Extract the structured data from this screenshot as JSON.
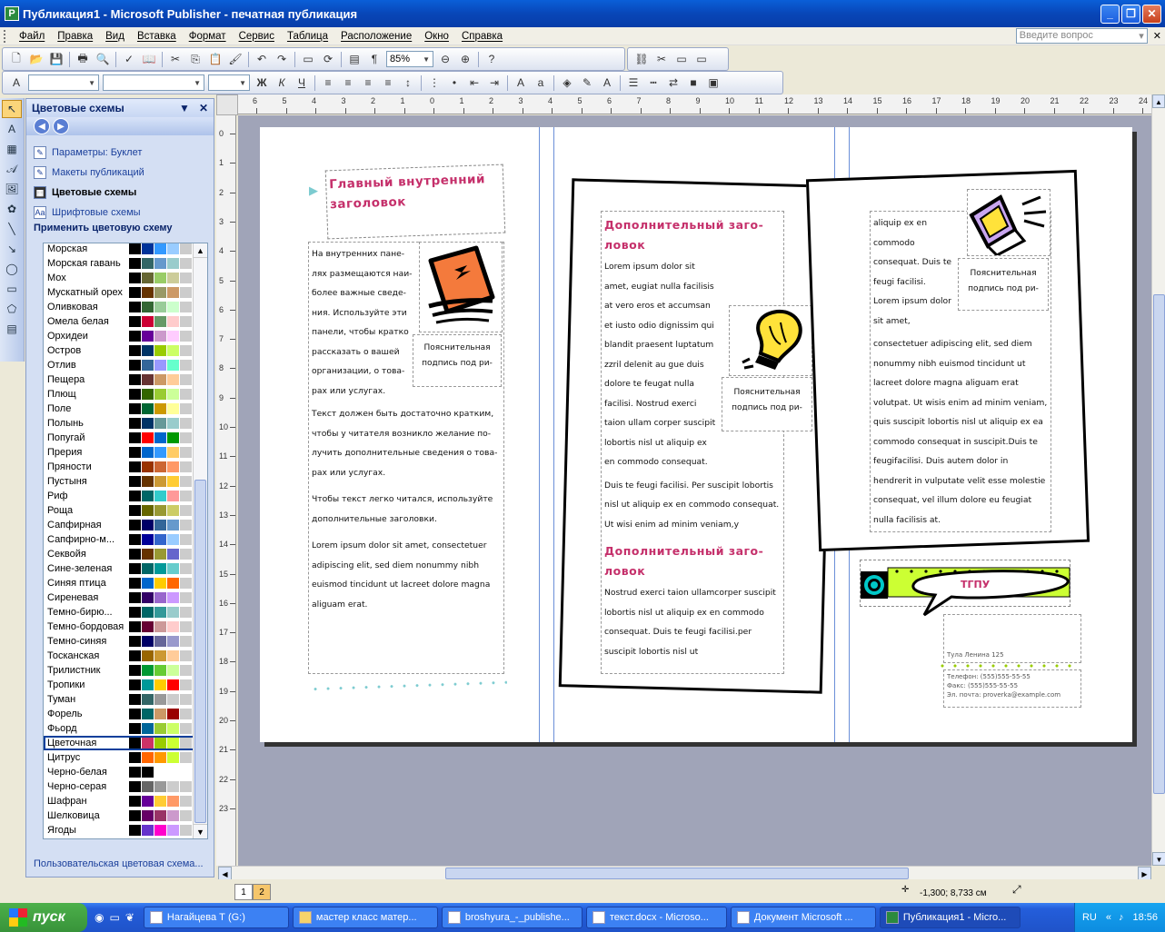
{
  "window": {
    "title": "Публикация1 - Microsoft Publisher - печатная публикация"
  },
  "menu": {
    "items": [
      "Файл",
      "Правка",
      "Вид",
      "Вставка",
      "Формат",
      "Сервис",
      "Таблица",
      "Расположение",
      "Окно",
      "Справка"
    ],
    "ask_placeholder": "Введите вопрос"
  },
  "toolbar": {
    "zoom": "85%"
  },
  "taskpane": {
    "title": "Цветовые схемы",
    "links": [
      {
        "label": "Параметры: Буклет",
        "icon": "options-icon"
      },
      {
        "label": "Макеты публикаций",
        "icon": "layouts-icon"
      },
      {
        "label": "Цветовые схемы",
        "icon": "color-schemes-icon"
      },
      {
        "label": "Шрифтовые схемы",
        "icon": "font-schemes-icon"
      }
    ],
    "apply_label": "Применить цветовую схему",
    "selected_scheme": "Цветочная",
    "custom_link": "Пользовательская цветовая схема...",
    "schemes": [
      {
        "name": "Морская",
        "colors": [
          "#000000",
          "#003399",
          "#3399ff",
          "#99ccff",
          "#cccccc"
        ]
      },
      {
        "name": "Морская гавань",
        "colors": [
          "#000000",
          "#336666",
          "#6699cc",
          "#99cccc",
          "#cccccc"
        ]
      },
      {
        "name": "Мох",
        "colors": [
          "#000000",
          "#666633",
          "#99cc66",
          "#cccc99",
          "#cccccc"
        ]
      },
      {
        "name": "Мускатный орех",
        "colors": [
          "#000000",
          "#663300",
          "#999966",
          "#cc9966",
          "#cccccc"
        ]
      },
      {
        "name": "Оливковая",
        "colors": [
          "#000000",
          "#336633",
          "#99cc99",
          "#ccffcc",
          "#cccccc"
        ]
      },
      {
        "name": "Омела белая",
        "colors": [
          "#000000",
          "#cc0033",
          "#669966",
          "#ffcccc",
          "#cccccc"
        ]
      },
      {
        "name": "Орхидеи",
        "colors": [
          "#000000",
          "#660099",
          "#cc99cc",
          "#ffccff",
          "#cccccc"
        ]
      },
      {
        "name": "Остров",
        "colors": [
          "#000000",
          "#003366",
          "#99cc00",
          "#ccff66",
          "#cccccc"
        ]
      },
      {
        "name": "Отлив",
        "colors": [
          "#000000",
          "#336699",
          "#9999ff",
          "#66ffcc",
          "#cccccc"
        ]
      },
      {
        "name": "Пещера",
        "colors": [
          "#000000",
          "#663333",
          "#cc9966",
          "#ffcc99",
          "#cccccc"
        ]
      },
      {
        "name": "Плющ",
        "colors": [
          "#000000",
          "#336600",
          "#99cc33",
          "#ccff99",
          "#cccccc"
        ]
      },
      {
        "name": "Поле",
        "colors": [
          "#000000",
          "#006633",
          "#cc9900",
          "#ffff99",
          "#cccccc"
        ]
      },
      {
        "name": "Полынь",
        "colors": [
          "#000000",
          "#003366",
          "#669999",
          "#99cccc",
          "#cccccc"
        ]
      },
      {
        "name": "Попугай",
        "colors": [
          "#000000",
          "#ff0000",
          "#0066cc",
          "#009900",
          "#cccccc"
        ]
      },
      {
        "name": "Прерия",
        "colors": [
          "#000000",
          "#0066cc",
          "#3399ff",
          "#ffcc66",
          "#cccccc"
        ]
      },
      {
        "name": "Пряности",
        "colors": [
          "#000000",
          "#993300",
          "#cc6633",
          "#ff9966",
          "#cccccc"
        ]
      },
      {
        "name": "Пустыня",
        "colors": [
          "#000000",
          "#663300",
          "#cc9933",
          "#ffcc33",
          "#cccccc"
        ]
      },
      {
        "name": "Риф",
        "colors": [
          "#000000",
          "#006666",
          "#33cccc",
          "#ff9999",
          "#cccccc"
        ]
      },
      {
        "name": "Роща",
        "colors": [
          "#000000",
          "#666600",
          "#999933",
          "#cccc66",
          "#cccccc"
        ]
      },
      {
        "name": "Сапфирная",
        "colors": [
          "#000000",
          "#000066",
          "#336699",
          "#6699cc",
          "#cccccc"
        ]
      },
      {
        "name": "Сапфирно-м...",
        "colors": [
          "#000000",
          "#000099",
          "#3366cc",
          "#99ccff",
          "#cccccc"
        ]
      },
      {
        "name": "Секвойя",
        "colors": [
          "#000000",
          "#663300",
          "#999933",
          "#6666cc",
          "#cccccc"
        ]
      },
      {
        "name": "Сине-зеленая",
        "colors": [
          "#000000",
          "#006666",
          "#009999",
          "#66cccc",
          "#cccccc"
        ]
      },
      {
        "name": "Синяя птица",
        "colors": [
          "#000000",
          "#0066cc",
          "#ffcc00",
          "#ff6600",
          "#cccccc"
        ]
      },
      {
        "name": "Сиреневая",
        "colors": [
          "#000000",
          "#330066",
          "#9966cc",
          "#cc99ff",
          "#cccccc"
        ]
      },
      {
        "name": "Темно-бирю...",
        "colors": [
          "#000000",
          "#006666",
          "#339999",
          "#99cccc",
          "#cccccc"
        ]
      },
      {
        "name": "Темно-бордовая",
        "colors": [
          "#000000",
          "#660033",
          "#cc9999",
          "#ffcccc",
          "#cccccc"
        ]
      },
      {
        "name": "Темно-синяя",
        "colors": [
          "#000000",
          "#000066",
          "#666699",
          "#9999cc",
          "#cccccc"
        ]
      },
      {
        "name": "Тосканская",
        "colors": [
          "#000000",
          "#996600",
          "#cc9933",
          "#ffcc99",
          "#cccccc"
        ]
      },
      {
        "name": "Трилистник",
        "colors": [
          "#000000",
          "#009933",
          "#66cc33",
          "#ccff99",
          "#cccccc"
        ]
      },
      {
        "name": "Тропики",
        "colors": [
          "#000000",
          "#009999",
          "#ffcc00",
          "#ff0000",
          "#cccccc"
        ]
      },
      {
        "name": "Туман",
        "colors": [
          "#000000",
          "#336666",
          "#999999",
          "#cccccc",
          "#cccccc"
        ]
      },
      {
        "name": "Форель",
        "colors": [
          "#000000",
          "#006666",
          "#cc9966",
          "#990000",
          "#cccccc"
        ]
      },
      {
        "name": "Фьорд",
        "colors": [
          "#000000",
          "#006699",
          "#99cc33",
          "#ccff66",
          "#cccccc"
        ]
      },
      {
        "name": "Цветочная",
        "colors": [
          "#000000",
          "#cc3366",
          "#99cc00",
          "#ccff33",
          "#cccccc"
        ]
      },
      {
        "name": "Цитрус",
        "colors": [
          "#000000",
          "#ff6600",
          "#ff9900",
          "#ccff33",
          "#cccccc"
        ]
      },
      {
        "name": "Черно-белая",
        "colors": [
          "#000000",
          "#000000",
          "#ffffff",
          "#ffffff",
          "#ffffff"
        ]
      },
      {
        "name": "Черно-серая",
        "colors": [
          "#000000",
          "#666666",
          "#999999",
          "#cccccc",
          "#cccccc"
        ]
      },
      {
        "name": "Шафран",
        "colors": [
          "#000000",
          "#660099",
          "#ffcc33",
          "#ff9966",
          "#cccccc"
        ]
      },
      {
        "name": "Шелковица",
        "colors": [
          "#000000",
          "#660066",
          "#993366",
          "#cc99cc",
          "#cccccc"
        ]
      },
      {
        "name": "Ягоды",
        "colors": [
          "#000000",
          "#6633cc",
          "#ff00cc",
          "#cc99ff",
          "#cccccc"
        ]
      }
    ]
  },
  "ruler": {
    "h_ticks": [
      "6",
      "5",
      "4",
      "3",
      "2",
      "1",
      "0",
      "1",
      "2",
      "3",
      "4",
      "5",
      "6",
      "7",
      "8",
      "9",
      "10",
      "11",
      "12",
      "13",
      "14",
      "15",
      "16",
      "17",
      "18",
      "19",
      "20",
      "21",
      "22",
      "23",
      "24",
      "25",
      "26",
      "27",
      "28",
      "29",
      "30",
      "31"
    ],
    "v_ticks": [
      "0",
      "1",
      "2",
      "3",
      "4",
      "5",
      "6",
      "7",
      "8",
      "9",
      "10",
      "11",
      "12",
      "13",
      "14",
      "15",
      "16",
      "17",
      "18",
      "19",
      "20",
      "21",
      "22",
      "23"
    ]
  },
  "publication": {
    "col1": {
      "heading": "Главный внутренний заголовок",
      "body1": "На внутренних пане-лях размещаются наи-более важные сведе-ния. Используйте эти панели, чтобы кратко рассказать о вашей организации, о това-рах или услугах.",
      "body2": "Текст должен быть достаточно кратким, чтобы у читателя возникло желание по-лучить дополнительные сведения о това-рах или услугах.",
      "body3": "Чтобы текст легко читался, используйте дополнительные заголовки.",
      "body4": "Lorem ipsum dolor sit amet, consectetuer adipiscing elit, sed diem nonummy nibh euismod tincidunt ut lacreet dolore magna aliguam erat.",
      "caption": "Пояснительная подпись под ри-"
    },
    "col2": {
      "heading1": "Дополнительный заго-ловок",
      "body1": "Lorem ipsum dolor sit amet, eugiat nulla facilisis at vero eros et accumsan et iusto odio dignissim qui blandit praesent luptatum zzril delenit au gue duis dolore te feugat nulla facilisi. Nostrud exerci taion ullam corper suscipit lobortis nisl ut aliquip ex en commodo consequat.",
      "body2": "Duis te feugi facilisi. Per suscipit lobortis nisl ut aliquip ex en commodo consequat. Ut wisi enim ad minim veniam,y",
      "heading2": "Дополнительный заго-ловок",
      "body3": "Nostrud exerci taion ullamcorper suscipit lobortis nisl ut aliquip ex en commodo consequat. Duis te feugi facilisi.per suscipit lobortis nisl ut",
      "caption": "Пояснительная подпись под ри-"
    },
    "col3": {
      "body1": "aliquip ex en commodo consequat. Duis te feugi facilisi. Lorem ipsum dolor sit amet,",
      "body2": "consectetuer adipiscing elit, sed diem nonummy nibh euismod tincidunt ut lacreet dolore magna aliguam erat volutpat. Ut wisis enim ad minim veniam, quis suscipit lobortis nisl ut aliquip ex ea commodo consequat in suscipit.Duis te feugifacilisi. Duis autem dolor in hendrerit in vulputate velit esse molestie consequat, vel illum dolore eu feugiat nulla facilisis at.",
      "caption": "Пояснительная подпись под ри-",
      "banner": "ТГПУ",
      "address": "Тула Ленина 125",
      "phone": "Телефон: (555)555-55-55",
      "fax": "Факс: (555)555-55-55",
      "email": "Эл. почта: proverka@example.com"
    }
  },
  "pages": [
    "1",
    "2"
  ],
  "status": {
    "coords": "-1,300; 8,733 см"
  },
  "taskbar": {
    "start": "пуск",
    "items": [
      "Нагайцева Т (G:)",
      "мастер класс матер...",
      "broshyura_-_publishe...",
      "текст.docx - Microso...",
      "Документ Microsoft ...",
      "Публикация1 - Micro..."
    ],
    "lang": "RU",
    "clock": "18:56"
  }
}
